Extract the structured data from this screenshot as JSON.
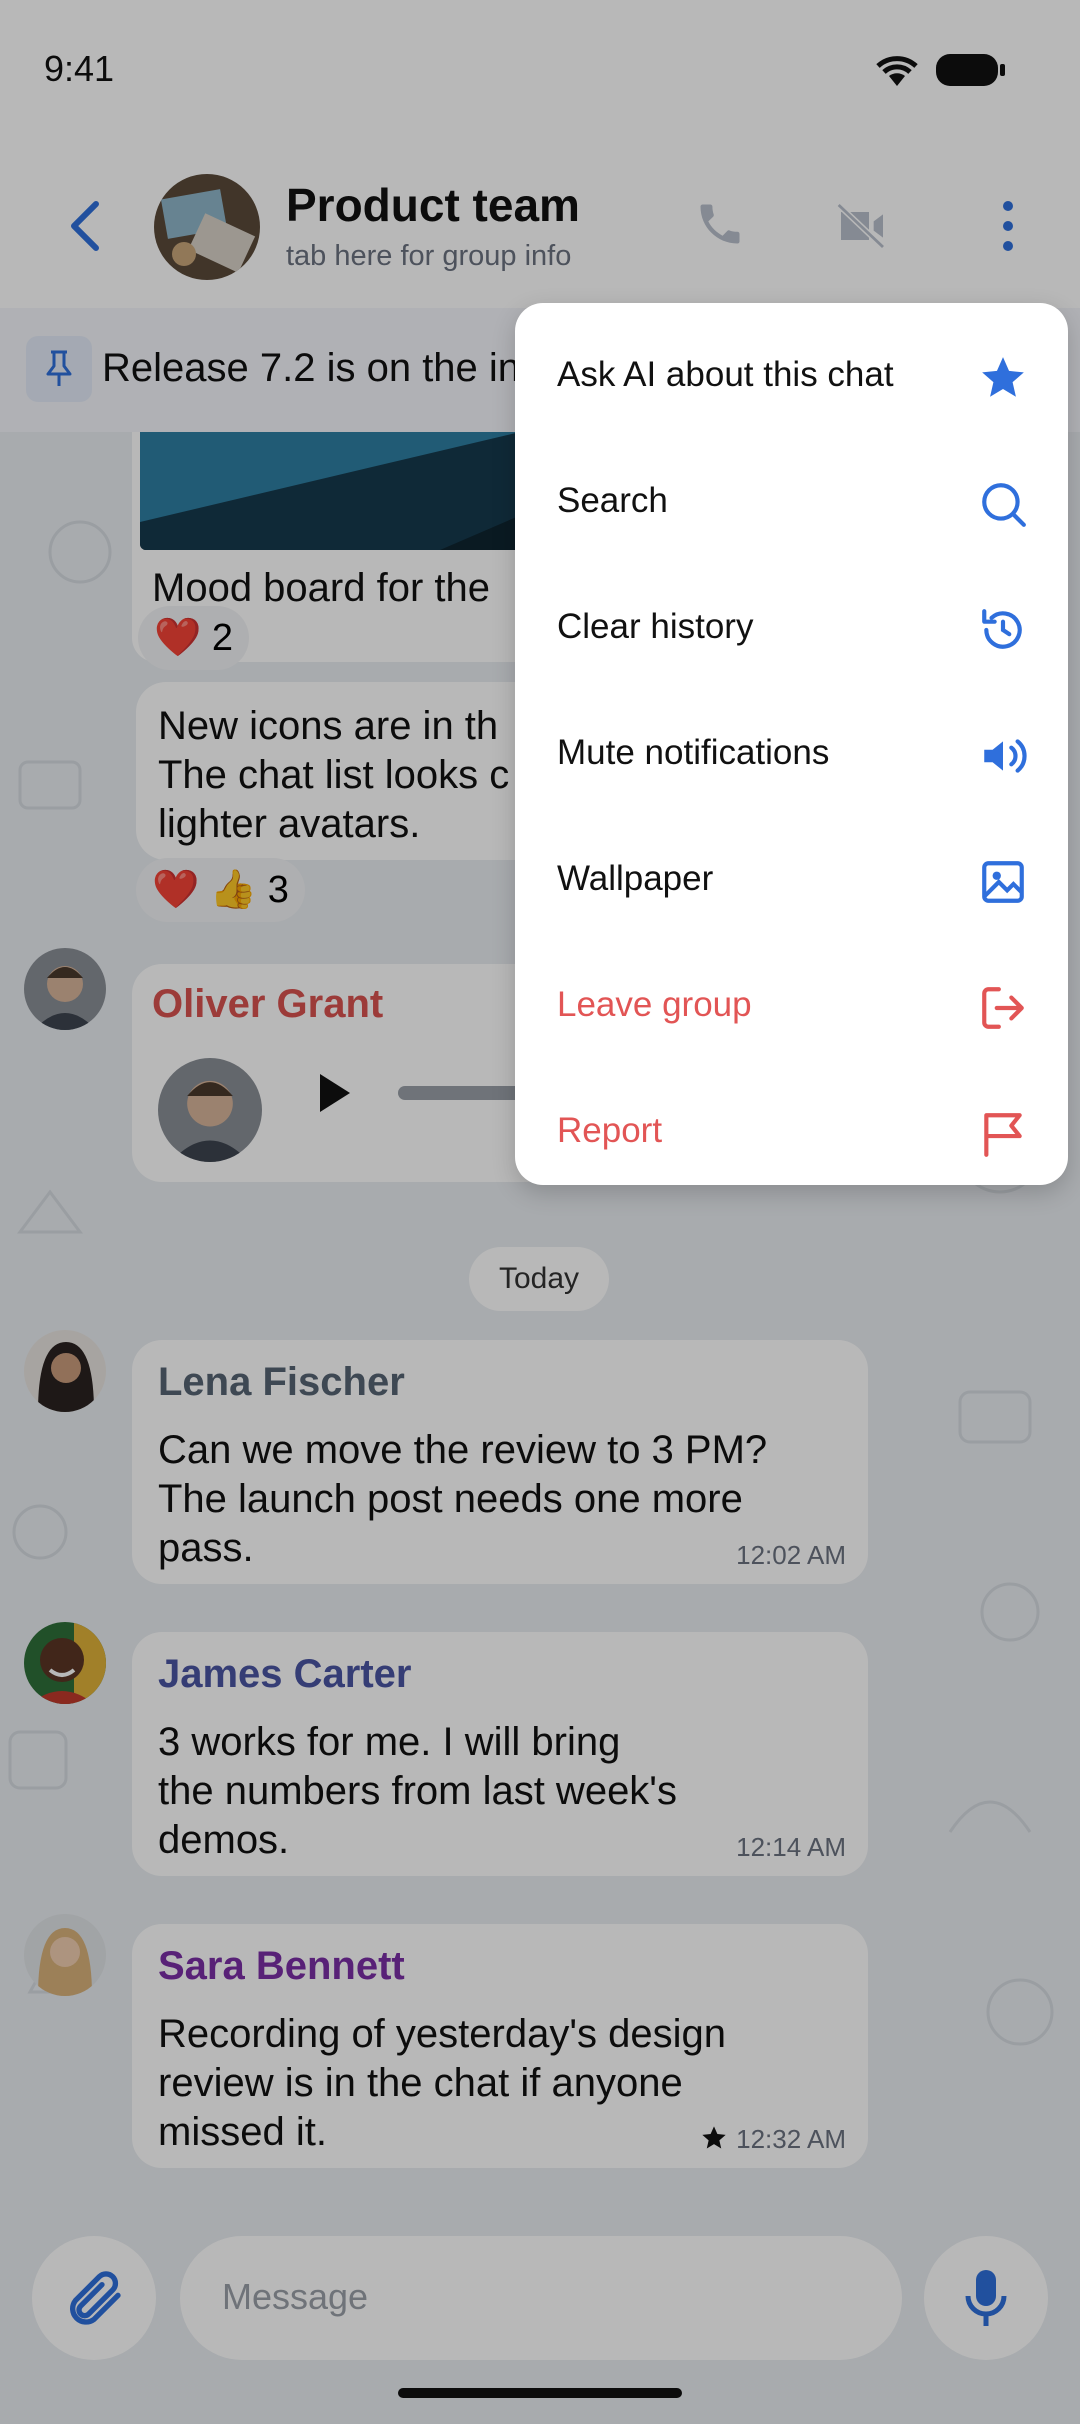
{
  "status_bar": {
    "time": "9:41"
  },
  "header": {
    "title": "Product team",
    "subtitle": "tab here for group info"
  },
  "pinned": {
    "text": "Release 7.2 is on the in"
  },
  "messages": {
    "m1": {
      "caption": "Mood board for the",
      "reactions": "❤️ 2"
    },
    "m2": {
      "line1": "New icons are in th",
      "line2": "The chat list looks c",
      "line3": "lighter avatars.",
      "reactions": "❤️ 👍 3"
    },
    "m3": {
      "sender": "Oliver Grant"
    },
    "date_separator": "Today",
    "m4": {
      "sender": "Lena Fischer",
      "line1": "Can we move the review to 3 PM?",
      "line2": "The launch post needs one more",
      "line3": "pass.",
      "time": "12:02 AM"
    },
    "m5": {
      "sender": "James Carter",
      "line1": "3 works for me. I will bring",
      "line2": "the numbers from last week's",
      "line3": "demos.",
      "time": "12:14 AM"
    },
    "m6": {
      "sender": "Sara Bennett",
      "line1": "Recording of yesterday's design",
      "line2": "review is in the chat if anyone",
      "line3": "missed it.",
      "time": "12:32 AM"
    }
  },
  "composer": {
    "placeholder": "Message"
  },
  "menu": {
    "items": [
      {
        "label": "Ask AI about this chat",
        "icon": "star-icon"
      },
      {
        "label": "Search",
        "icon": "search-icon"
      },
      {
        "label": "Clear history",
        "icon": "history-icon"
      },
      {
        "label": "Mute notifications",
        "icon": "speaker-icon"
      },
      {
        "label": "Wallpaper",
        "icon": "image-icon"
      },
      {
        "label": "Leave group",
        "icon": "exit-icon"
      },
      {
        "label": "Report",
        "icon": "flag-icon"
      }
    ]
  },
  "colors": {
    "accent": "#2f6fdc",
    "danger": "#e25555",
    "sender_oliver": "#d9534f",
    "sender_lena": "#566574",
    "sender_james": "#4a55a2",
    "sender_sara": "#7b2fa6"
  }
}
